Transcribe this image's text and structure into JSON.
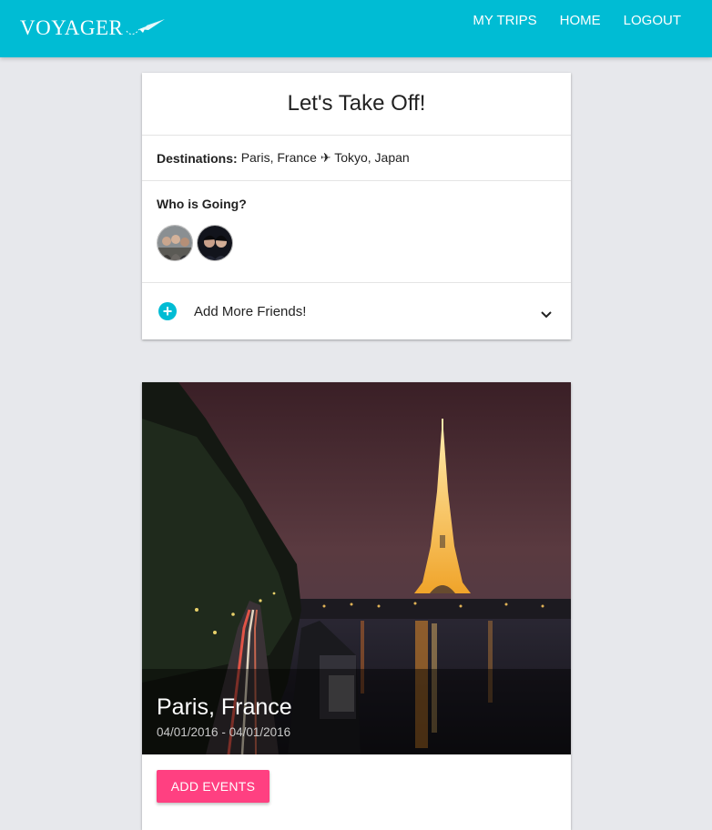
{
  "brand": {
    "name": "VOYAGER",
    "icon": "paper-plane-icon"
  },
  "nav": {
    "links": [
      "MY TRIPS",
      "HOME",
      "LOGOUT"
    ]
  },
  "trip": {
    "title": "Let's Take Off!",
    "destinations_label": "Destinations:",
    "destinations_value": "Paris, France ✈ Tokyo, Japan",
    "who_label": "Who is Going?",
    "avatars": [
      "friend-avatar-1",
      "friend-avatar-2"
    ],
    "add_friends_label": "Add More Friends!",
    "add_icon": "plus-circle-icon",
    "expand_icon": "chevron-down-icon"
  },
  "city": {
    "name": "Paris, France",
    "dates": "04/01/2016 - 04/01/2016",
    "add_events_label": "ADD EVENTS"
  },
  "colors": {
    "primary": "#00bcd4",
    "accent": "#ff4081",
    "background": "#e7e8ec"
  }
}
